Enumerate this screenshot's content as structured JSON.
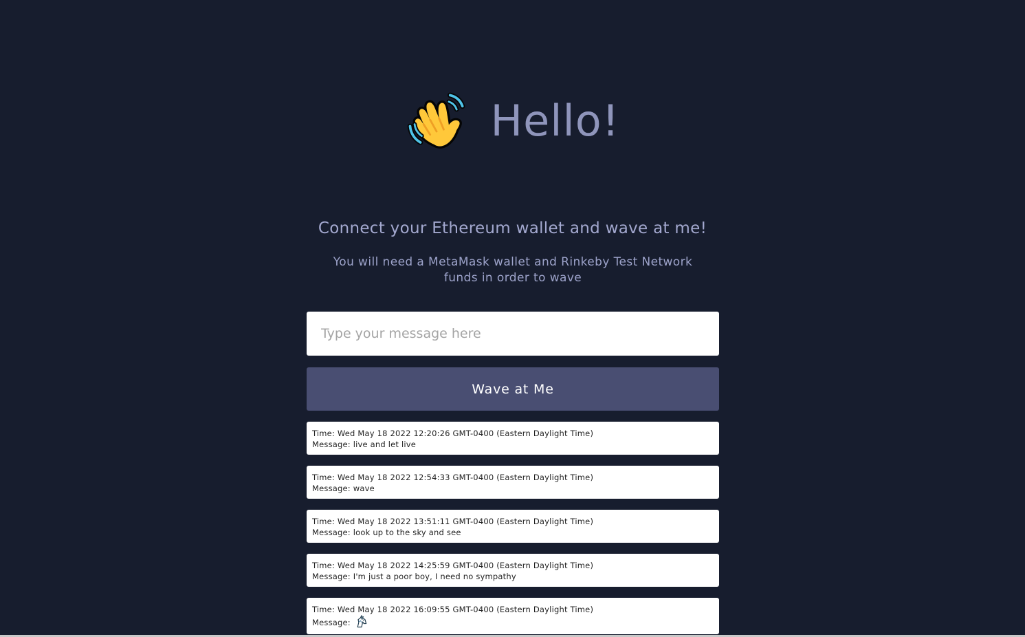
{
  "hero": {
    "icon": "waving-hand-icon",
    "title": "Hello!"
  },
  "subtitle": "Connect your Ethereum wallet and wave at me!",
  "note": "You will need a MetaMask wallet and Rinkeby Test Network funds in order to wave",
  "message_input": {
    "placeholder": "Type your message here",
    "value": ""
  },
  "wave_button": {
    "label": "Wave at Me"
  },
  "waves": [
    {
      "time": "Time: Wed May 18 2022 12:20:26 GMT-0400 (Eastern Daylight Time)",
      "message": "Message: live and let live"
    },
    {
      "time": "Time: Wed May 18 2022 12:54:33 GMT-0400 (Eastern Daylight Time)",
      "message": "Message: wave"
    },
    {
      "time": "Time: Wed May 18 2022 13:51:11 GMT-0400 (Eastern Daylight Time)",
      "message": "Message: look up to the sky and see"
    },
    {
      "time": "Time: Wed May 18 2022 14:25:59 GMT-0400 (Eastern Daylight Time)",
      "message": "Message: I'm just a poor boy, I need no sympathy"
    },
    {
      "time": "Time: Wed May 18 2022 16:09:55 GMT-0400 (Eastern Daylight Time)",
      "message": "Message:",
      "emoji_icon": "unicorn-icon"
    }
  ],
  "colors": {
    "background": "#171d2e",
    "heading": "#8f95bb",
    "subtitle": "#a3a8cf",
    "button": "#494e72",
    "card": "#ffffff"
  }
}
